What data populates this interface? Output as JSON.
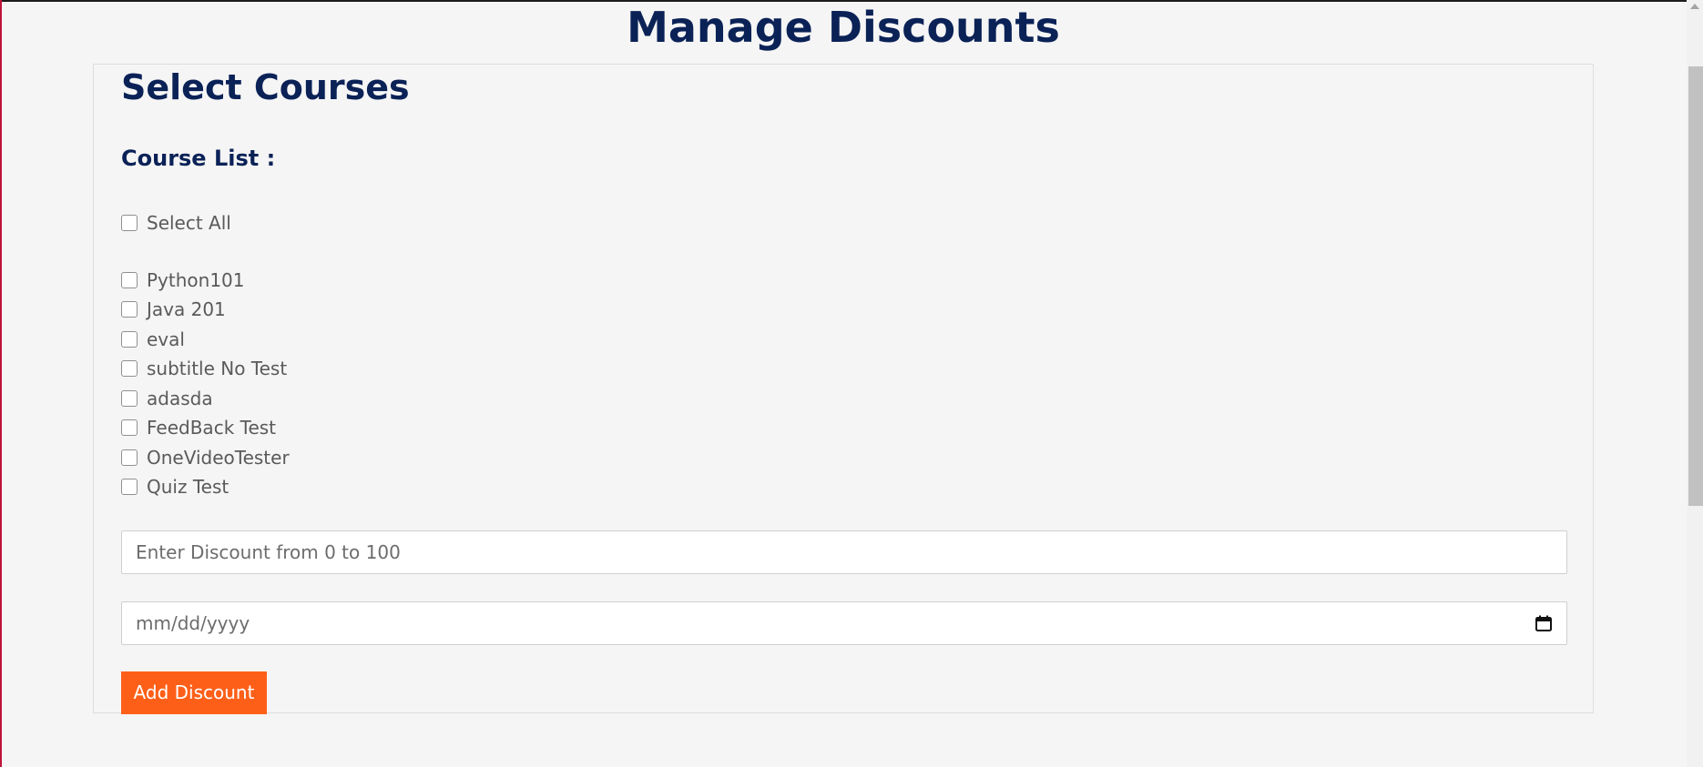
{
  "page": {
    "title": "Manage Discounts"
  },
  "card": {
    "title": "Select Courses",
    "list_heading": "Course List :",
    "select_all_label": "Select All",
    "courses": [
      {
        "label": "Python101",
        "checked": false
      },
      {
        "label": "Java 201",
        "checked": false
      },
      {
        "label": "eval",
        "checked": false
      },
      {
        "label": "subtitle No Test",
        "checked": false
      },
      {
        "label": "adasda",
        "checked": false
      },
      {
        "label": "FeedBack Test",
        "checked": false
      },
      {
        "label": "OneVideoTester",
        "checked": false
      },
      {
        "label": "Quiz Test",
        "checked": false
      }
    ],
    "discount_placeholder": "Enter Discount from 0 to 100",
    "date_placeholder": "mm/dd/yyyy",
    "add_button_label": "Add Discount"
  },
  "icons": {
    "date_picker": "calendar-icon"
  },
  "colors": {
    "heading": "#0b2257",
    "button": "#fe5f18",
    "background": "#f5f5f5"
  }
}
